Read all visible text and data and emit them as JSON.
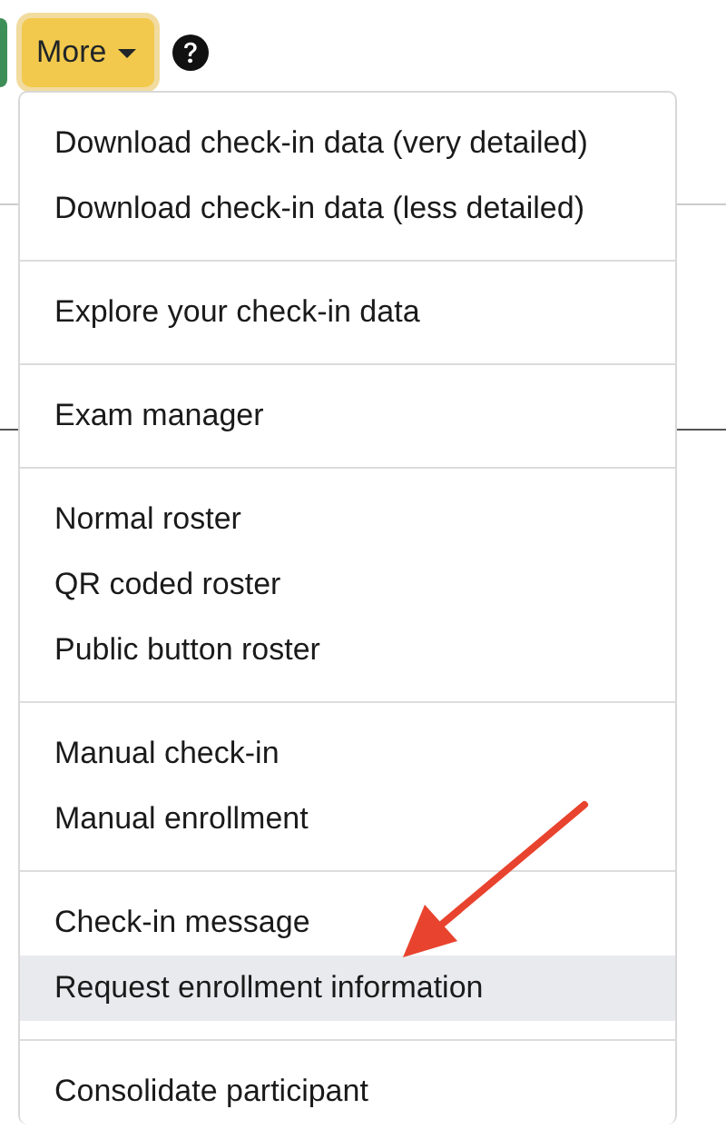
{
  "toolbar": {
    "more_button": {
      "label": "More",
      "expanded": true
    }
  },
  "menu": {
    "groups": [
      {
        "items": [
          {
            "label": "Download check-in data (very detailed)",
            "selected": false
          },
          {
            "label": "Download check-in data (less detailed)",
            "selected": false
          }
        ]
      },
      {
        "items": [
          {
            "label": "Explore your check-in data",
            "selected": false
          }
        ]
      },
      {
        "items": [
          {
            "label": "Exam manager",
            "selected": false
          }
        ]
      },
      {
        "items": [
          {
            "label": "Normal roster",
            "selected": false
          },
          {
            "label": "QR coded roster",
            "selected": false
          },
          {
            "label": "Public button roster",
            "selected": false
          }
        ]
      },
      {
        "items": [
          {
            "label": "Manual check-in",
            "selected": false
          },
          {
            "label": "Manual enrollment",
            "selected": false
          }
        ]
      },
      {
        "items": [
          {
            "label": "Check-in message",
            "selected": false
          },
          {
            "label": "Request enrollment information",
            "selected": true
          }
        ]
      },
      {
        "items": [
          {
            "label": "Consolidate participant",
            "selected": false
          }
        ]
      }
    ]
  }
}
